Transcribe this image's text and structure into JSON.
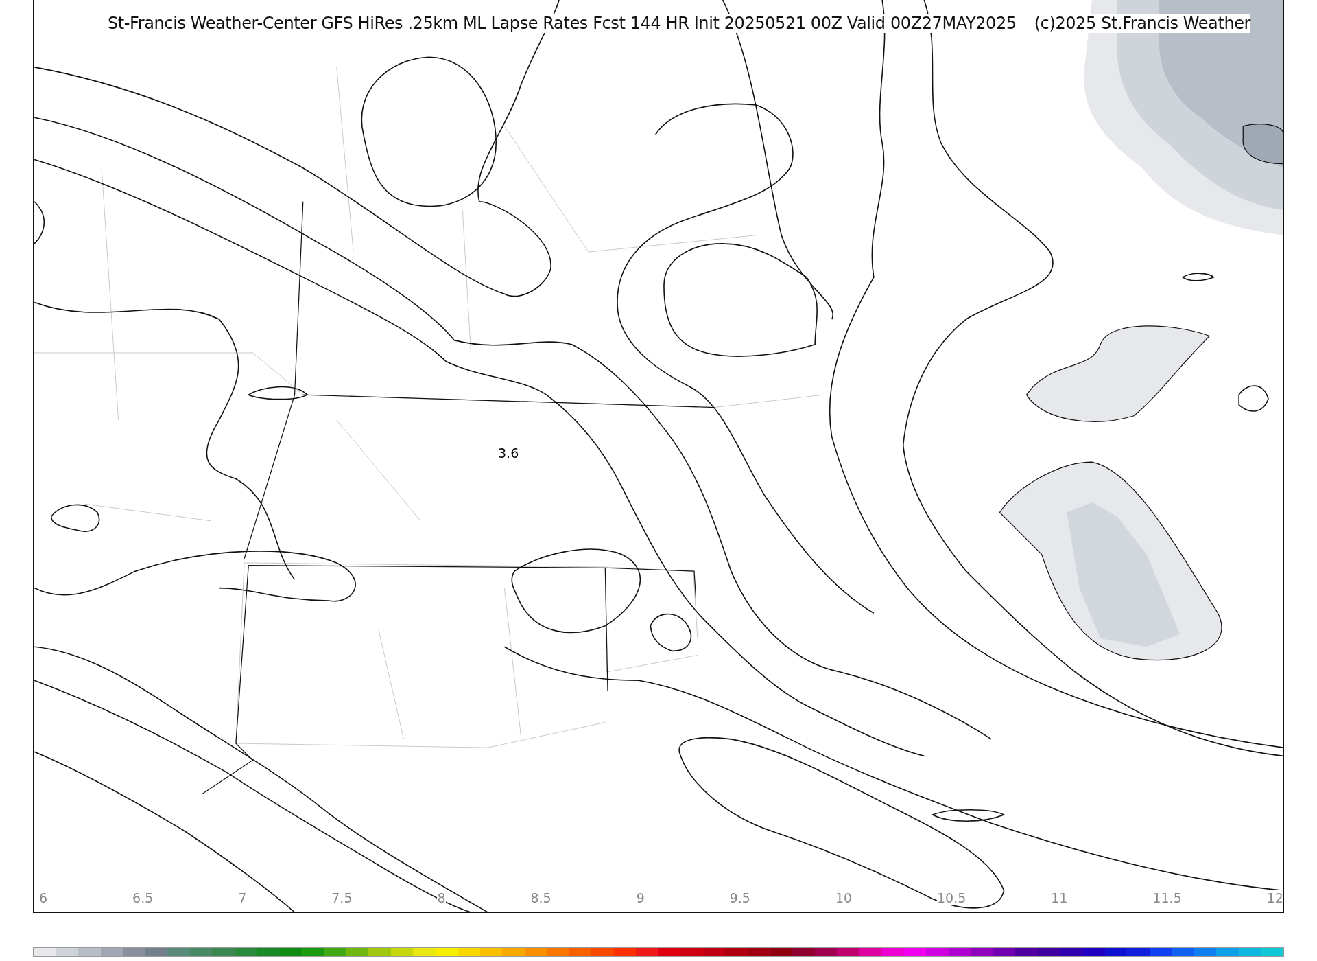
{
  "title": "St-Francis Weather-Center GFS HiRes .25km ML Lapse Rates  Fcst 144 HR Init 20250521 00Z  Valid 00Z27MAY2025",
  "copyright": "(c)2025 St.Francis Weather",
  "contour_labels": [
    "3.6"
  ],
  "colorbar": {
    "ticks": [
      "6",
      "6.5",
      "7",
      "7.5",
      "8",
      "8.5",
      "9",
      "9.5",
      "10",
      "10.5",
      "11",
      "11.5",
      "12"
    ],
    "segments": [
      {
        "color": "#e6e8ec"
      },
      {
        "color": "#d0d4da"
      },
      {
        "color": "#b8bec8"
      },
      {
        "color": "#a0a8b4"
      },
      {
        "color": "#8890a0"
      },
      {
        "color": "#74808e"
      },
      {
        "color": "#5a8a7a"
      },
      {
        "color": "#4a8a64"
      },
      {
        "color": "#3a8850"
      },
      {
        "color": "#2a8a3c"
      },
      {
        "color": "#1a8a28"
      },
      {
        "color": "#108a10"
      },
      {
        "color": "#1a9a10"
      },
      {
        "color": "#40a810"
      },
      {
        "color": "#70b810"
      },
      {
        "color": "#a0c810"
      },
      {
        "color": "#c8d810"
      },
      {
        "color": "#e8e810"
      },
      {
        "color": "#f8f000"
      },
      {
        "color": "#f8d800"
      },
      {
        "color": "#f8c000"
      },
      {
        "color": "#f8a800"
      },
      {
        "color": "#f89000"
      },
      {
        "color": "#f87800"
      },
      {
        "color": "#f86000"
      },
      {
        "color": "#f84800"
      },
      {
        "color": "#f83000"
      },
      {
        "color": "#f01818"
      },
      {
        "color": "#e00010"
      },
      {
        "color": "#d00010"
      },
      {
        "color": "#c00010"
      },
      {
        "color": "#b00010"
      },
      {
        "color": "#a00010"
      },
      {
        "color": "#900010"
      },
      {
        "color": "#900030"
      },
      {
        "color": "#a00050"
      },
      {
        "color": "#c00070"
      },
      {
        "color": "#e000a0"
      },
      {
        "color": "#f000d0"
      },
      {
        "color": "#f000f0"
      },
      {
        "color": "#d000e0"
      },
      {
        "color": "#b000d0"
      },
      {
        "color": "#9000c0"
      },
      {
        "color": "#7000b0"
      },
      {
        "color": "#5000a0"
      },
      {
        "color": "#4000a0"
      },
      {
        "color": "#3000b0"
      },
      {
        "color": "#2000c0"
      },
      {
        "color": "#1010d0"
      },
      {
        "color": "#1020e0"
      },
      {
        "color": "#1040f0"
      },
      {
        "color": "#1060f0"
      },
      {
        "color": "#1080f0"
      },
      {
        "color": "#10a0e8"
      },
      {
        "color": "#10b8e0"
      },
      {
        "color": "#10c8d8"
      }
    ]
  }
}
